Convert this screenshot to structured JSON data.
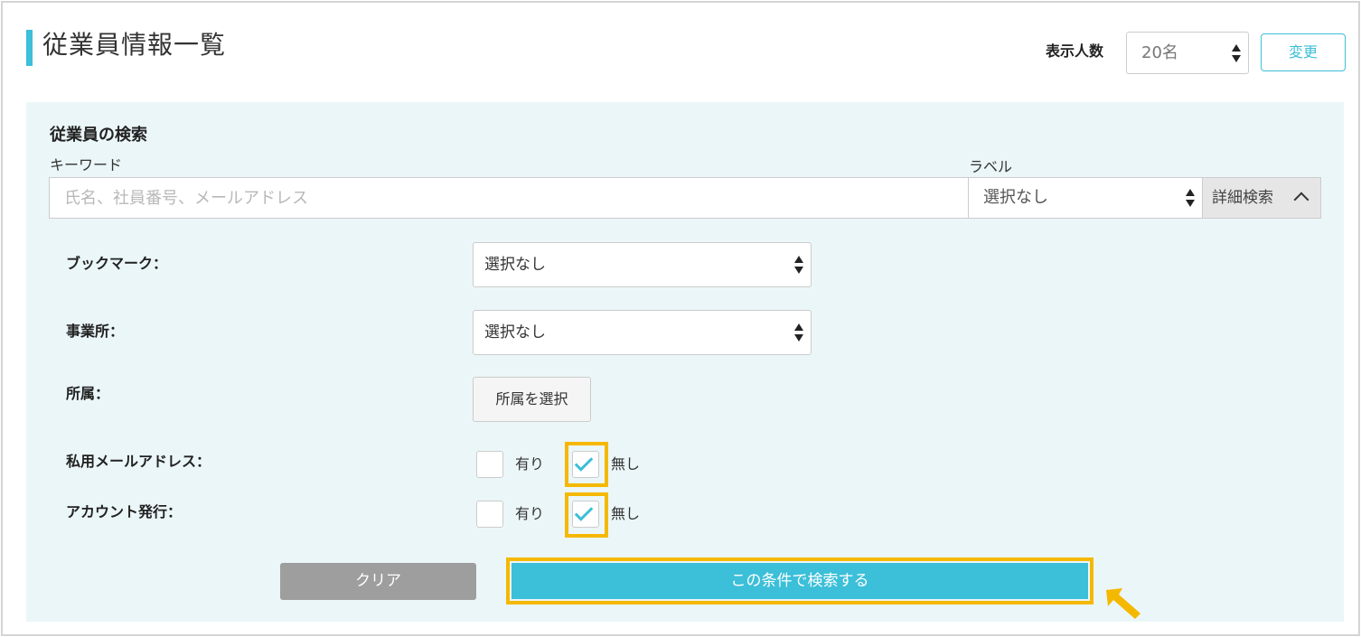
{
  "header": {
    "title": "従業員情報一覧",
    "display_count_label": "表示人数",
    "display_count_value": "20名",
    "change_button": "変更"
  },
  "search": {
    "heading": "従業員の検索",
    "keyword_label": "キーワード",
    "keyword_placeholder": "氏名、社員番号、メールアドレス",
    "keyword_value": "",
    "label_label": "ラベル",
    "label_value": "選択なし",
    "advanced_button": "詳細検索"
  },
  "filters": {
    "bookmark": {
      "label": "ブックマーク：",
      "value": "選択なし"
    },
    "office": {
      "label": "事業所：",
      "value": "選択なし"
    },
    "department": {
      "label": "所属：",
      "button": "所属を選択"
    },
    "private_email": {
      "label": "私用メールアドレス：",
      "option_yes": "有り",
      "option_no": "無し",
      "yes_checked": false,
      "no_checked": true
    },
    "account_issue": {
      "label": "アカウント発行：",
      "option_yes": "有り",
      "option_no": "無し",
      "yes_checked": false,
      "no_checked": true
    }
  },
  "actions": {
    "clear_button": "クリア",
    "search_button": "この条件で検索する"
  },
  "colors": {
    "accent": "#3cbfd8",
    "highlight": "#f5b800",
    "panel_background": "#ebf6f8",
    "clear_button": "#9e9e9e"
  },
  "icons": {
    "select_arrows": "updown-arrows-icon",
    "advanced_toggle": "chevron-up-icon",
    "checkbox_mark": "check-icon",
    "pointer": "arrow-pointer-icon"
  }
}
